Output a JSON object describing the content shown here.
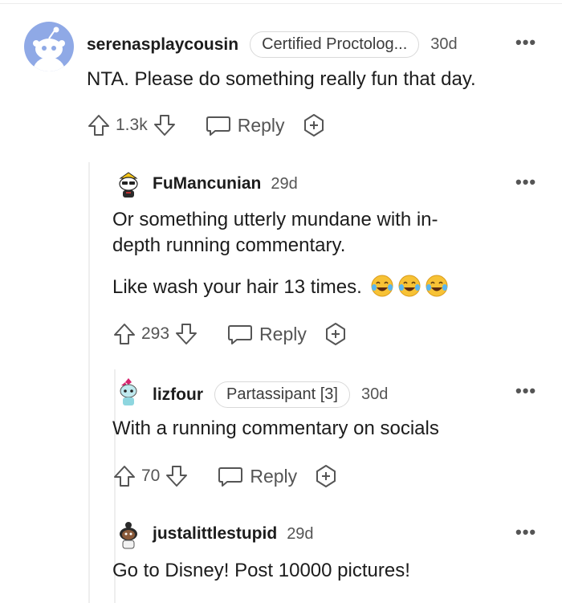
{
  "comments": [
    {
      "username": "serenasplaycousin",
      "flair": "Certified Proctolog...",
      "age": "30d",
      "text": "NTA. Please do something really fun that day.",
      "score": "1.3k",
      "reply_label": "Reply"
    },
    {
      "username": "FuMancunian",
      "age": "29d",
      "text_line1": "Or something utterly mundane with in-",
      "text_line2": "depth running commentary.",
      "text2": "Like wash your hair 13 times.",
      "emojis": [
        "tears-of-joy-emoji",
        "tears-of-joy-emoji",
        "tears-of-joy-emoji"
      ],
      "score": "293",
      "reply_label": "Reply"
    },
    {
      "username": "lizfour",
      "flair": "Partassipant [3]",
      "age": "30d",
      "text": "With a running commentary on socials",
      "score": "70",
      "reply_label": "Reply"
    },
    {
      "username": "justalittlestupid",
      "age": "29d",
      "text": "Go to Disney! Post 10000 pictures!"
    }
  ]
}
